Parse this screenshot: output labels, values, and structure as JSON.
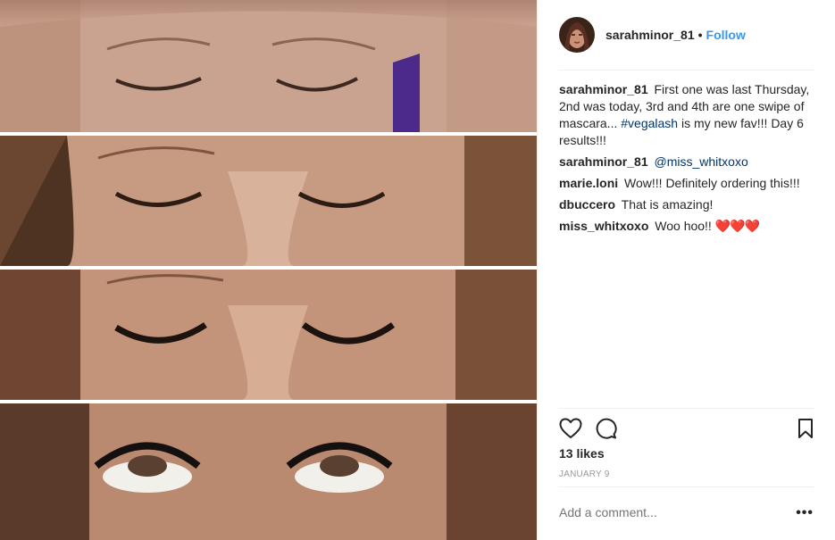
{
  "post": {
    "username": "sarahminor_81",
    "separator": "•",
    "follow_label": "Follow",
    "likes": "13 likes",
    "date": "JANUARY 9",
    "comment_placeholder": "Add a comment...",
    "more_label": "•••"
  },
  "caption": {
    "user": "sarahminor_81",
    "text_before": "First one was last Thursday, 2nd was today, 3rd and 4th are one swipe of mascara... ",
    "hashtag": "#vegalash",
    "text_after": " is my new fav!!! Day 6 results!!!"
  },
  "comments": [
    {
      "user": "sarahminor_81",
      "mention": "@miss_whitxoxo",
      "text": ""
    },
    {
      "user": "marie.loni",
      "mention": "",
      "text": "Wow!!! Definitely ordering this!!!"
    },
    {
      "user": "dbuccero",
      "mention": "",
      "text": "That is amazing!"
    },
    {
      "user": "miss_whitxoxo",
      "mention": "",
      "text": "Woo hoo!! ",
      "emoji": "❤️❤️❤️"
    }
  ],
  "colors": {
    "link_blue": "#3897f0",
    "hashtag_blue": "#003569",
    "heart_red": "#ed4956",
    "muted": "#999999"
  },
  "icons": [
    "heart-icon",
    "comment-icon",
    "bookmark-icon",
    "more-options-icon"
  ]
}
